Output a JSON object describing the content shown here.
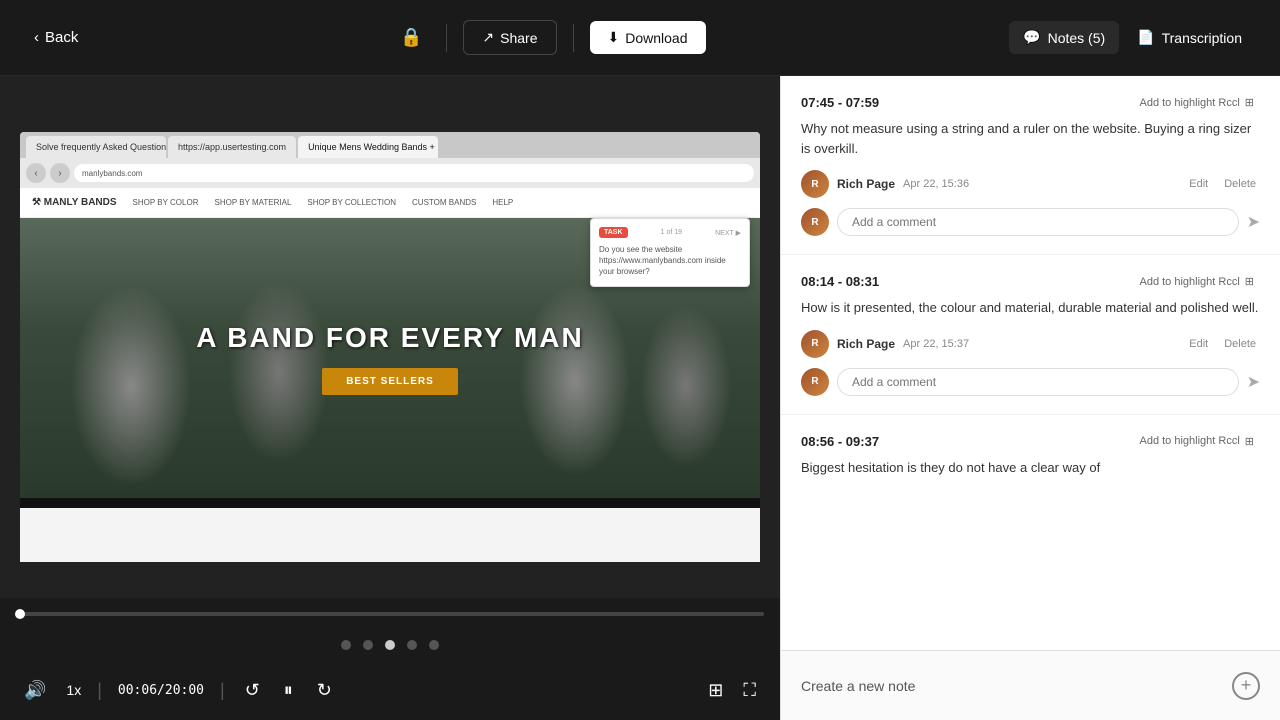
{
  "header": {
    "back_label": "Back",
    "lock_icon": "🔒",
    "share_label": "Share",
    "download_icon": "⬇",
    "download_label": "Download",
    "notes_icon": "💬",
    "notes_label": "Notes (5)",
    "transcription_icon": "📄",
    "transcription_label": "Transcription"
  },
  "video": {
    "current_time": "00:06",
    "total_time": "20:00",
    "speed": "1x",
    "progress_percent": 0.5
  },
  "dots": [
    {
      "active": false
    },
    {
      "active": false
    },
    {
      "active": true
    },
    {
      "active": false
    },
    {
      "active": false
    }
  ],
  "browser": {
    "url": "manlybands.com",
    "tabs": [
      {
        "label": "Solve frequently Asked Questions",
        "active": false
      },
      {
        "label": "https://app.usertesting.com",
        "active": false
      },
      {
        "label": "Unique Mens Wedding Bands +",
        "active": true
      }
    ],
    "hero_text": "A BAND FOR EVERY MAN",
    "hero_btn": "BEST SELLERS",
    "nav_links": [
      "SHOP BY COLOR",
      "SHOP BY MATERIAL",
      "SHOP BY COLLECTION",
      "CUSTOM BANDS",
      "HELP"
    ],
    "task_badge": "TASK",
    "task_progress": "1 of 19",
    "task_next": "NEXT ▶",
    "task_text": "Do you see the website https://www.manlybands.com inside your browser?"
  },
  "notes": [
    {
      "id": "note1",
      "time_range": "07:45 - 07:59",
      "highlight_label": "Add to highlight Rccl",
      "text": "Why not measure using a string and a ruler on the website. Buying a ring sizer is overkill.",
      "author": "Rich Page",
      "date": "Apr 22, 15:36",
      "edit_label": "Edit",
      "delete_label": "Delete",
      "comment_placeholder": "Add a comment"
    },
    {
      "id": "note2",
      "time_range": "08:14 - 08:31",
      "highlight_label": "Add to highlight Rccl",
      "text": "How is it presented, the colour and material, durable material and polished well.",
      "author": "Rich Page",
      "date": "Apr 22, 15:37",
      "edit_label": "Edit",
      "delete_label": "Delete",
      "comment_placeholder": "Add a comment"
    },
    {
      "id": "note3",
      "time_range": "08:56 - 09:37",
      "highlight_label": "Add to highlight Rccl",
      "text": "Biggest hesitation is they do not have a clear way of",
      "author": "",
      "date": ""
    }
  ],
  "create_note": {
    "label": "Create a new note",
    "icon": "+"
  }
}
